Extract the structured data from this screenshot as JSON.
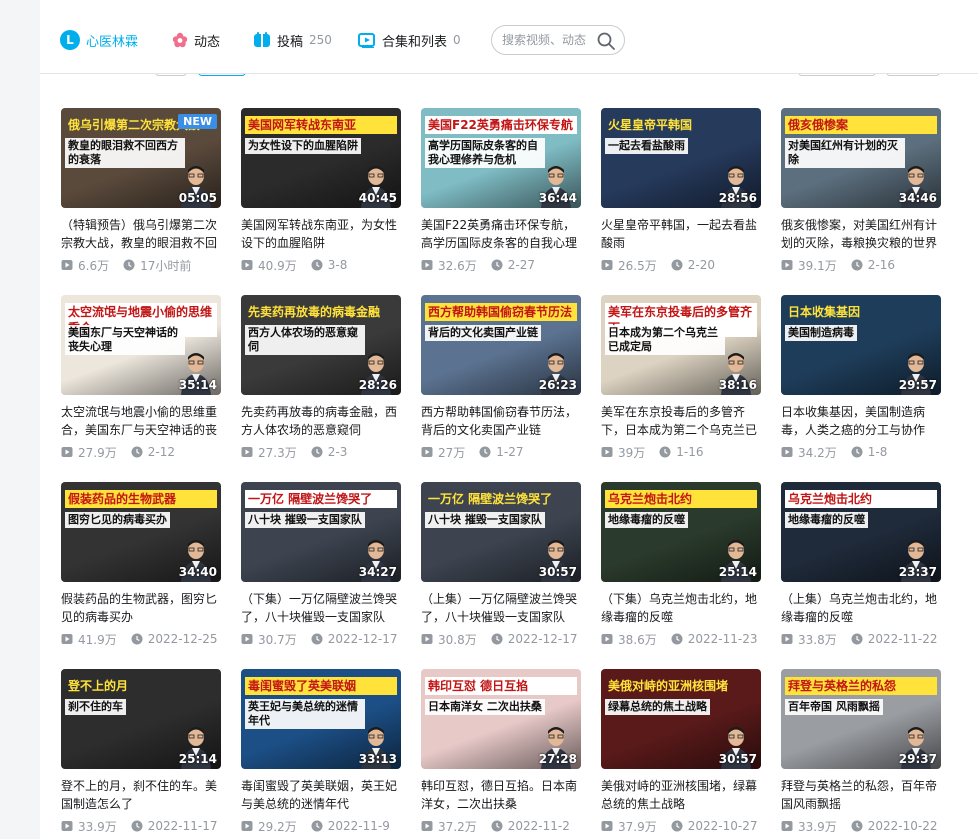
{
  "nav": {
    "home": {
      "label": "心医林霖",
      "badge": "L"
    },
    "dynamic": {
      "label": "动态"
    },
    "posts": {
      "label": "投稿",
      "count": "250"
    },
    "collections": {
      "label": "合集和列表",
      "count": "0"
    },
    "search": {
      "placeholder": "搜索视频、动态"
    }
  },
  "colors": {
    "accent": "#00aeec"
  },
  "videos": [
    {
      "title": "（特辑预告）俄乌引爆第二次宗教大战，教皇的眼泪救不回西方",
      "views": "6.6万",
      "date": "17小时前",
      "duration": "05:05",
      "cover_text": "俄乌引爆第二次宗教大战",
      "cover_sub": "教皇的眼泪救不回西方的衰落",
      "tag": "NEW",
      "bg": "#5a4a3c"
    },
    {
      "title": "美国网军转战东南亚，为女性设下的血腥陷阱",
      "views": "40.9万",
      "date": "3-8",
      "duration": "40:45",
      "cover_text": "美国网军转战东南亚",
      "cover_sub": "为女性设下的血腥陷阱",
      "bg": "#2b2b2b"
    },
    {
      "title": "美国F22英勇痛击环保专航，高学历国际皮条客的自我心理修养与危机",
      "views": "32.6万",
      "date": "2-27",
      "duration": "36:44",
      "cover_text": "美国F22英勇痛击环保专航",
      "cover_sub": "高学历国际皮条客的自我心理修养与危机",
      "bg": "#7fbcc4"
    },
    {
      "title": "火星皇帝平韩国，一起去看盐酸雨",
      "views": "26.5万",
      "date": "2-20",
      "duration": "28:56",
      "cover_text": "火星皇帝平韩国",
      "cover_sub": "一起去看盐酸雨",
      "bg": "#263a5c"
    },
    {
      "title": "俄亥俄惨案，对美国红州有计划的灭除，毒粮换灾粮的世界危机",
      "views": "39.1万",
      "date": "2-16",
      "duration": "34:46",
      "cover_text": "俄亥俄惨案",
      "cover_sub": "对美国红州有计划的灭除",
      "bg": "#5c6f7e"
    },
    {
      "title": "太空流氓与地震小偷的思维重合，美国东厂与天空神话的丧失心理",
      "views": "27.9万",
      "date": "2-12",
      "duration": "35:14",
      "cover_text": "太空流氓与地震小偷的思维重合",
      "cover_sub": "美国东厂与天空神话的丧失心理",
      "bg": "#ece6dc"
    },
    {
      "title": "先卖药再放毒的病毒金融，西方人体农场的恶意窥伺",
      "views": "27.3万",
      "date": "2-3",
      "duration": "28:26",
      "cover_text": "先卖药再放毒的病毒金融",
      "cover_sub": "西方人体农场的恶意窥伺",
      "bg": "#3a3a3a"
    },
    {
      "title": "西方帮助韩国偷窃春节历法，背后的文化卖国产业链",
      "views": "27万",
      "date": "1-27",
      "duration": "26:23",
      "cover_text": "西方帮助韩国偷窃春节历法",
      "cover_sub": "背后的文化卖国产业链",
      "bg": "#5b7290"
    },
    {
      "title": "美军在东京投毒后的多管齐下，日本成为第二个乌克兰已成定局",
      "views": "39万",
      "date": "1-16",
      "duration": "38:16",
      "cover_text": "美军在东京投毒后的多管齐下",
      "cover_sub": "日本成为第二个乌克兰已成定局",
      "bg": "#ddd3c2"
    },
    {
      "title": "日本收集基因，美国制造病毒，人类之癌的分工与协作",
      "views": "34.2万",
      "date": "1-8",
      "duration": "29:57",
      "cover_text": "日本收集基因",
      "cover_sub": "美国制造病毒",
      "bg": "#1e3d5a"
    },
    {
      "title": "假装药品的生物武器，图穷匕见的病毒买办",
      "views": "41.9万",
      "date": "2022-12-25",
      "duration": "34:40",
      "cover_text": "假装药品的生物武器",
      "cover_sub": "图穷匕见的病毒买办",
      "bg": "#333333"
    },
    {
      "title": "（下集）一万亿隔壁波兰馋哭了，八十块催毁一支国家队",
      "views": "30.7万",
      "date": "2022-12-17",
      "duration": "34:27",
      "cover_text": "一万亿 隔壁波兰馋哭了",
      "cover_sub": "八十块 摧毁一支国家队",
      "bg": "#3d4450"
    },
    {
      "title": "（上集）一万亿隔壁波兰馋哭了，八十块催毁一支国家队",
      "views": "30.8万",
      "date": "2022-12-17",
      "duration": "30:57",
      "cover_text": "一万亿 隔壁波兰馋哭了",
      "cover_sub": "八十块 摧毁一支国家队",
      "bg": "#3d4450"
    },
    {
      "title": "（下集）乌克兰炮击北约，地缘毒瘤的反噬",
      "views": "38.6万",
      "date": "2022-11-23",
      "duration": "25:14",
      "cover_text": "乌克兰炮击北约",
      "cover_sub": "地缘毒瘤的反噬",
      "bg": "#2a3a2c"
    },
    {
      "title": "（上集）乌克兰炮击北约，地缘毒瘤的反噬",
      "views": "33.8万",
      "date": "2022-11-22",
      "duration": "23:37",
      "cover_text": "乌克兰炮击北约",
      "cover_sub": "地缘毒瘤的反噬",
      "bg": "#1f2a3a"
    },
    {
      "title": "登不上的月，刹不住的车。美国制造怎么了",
      "views": "33.9万",
      "date": "2022-11-17",
      "duration": "25:14",
      "cover_text": "登不上的月",
      "cover_sub": "刹不住的车",
      "bg": "#2d2d2d"
    },
    {
      "title": "毒闺蜜毁了英美联姻，英王妃与美总统的迷情年代",
      "views": "29.2万",
      "date": "2022-11-9",
      "duration": "33:13",
      "cover_text": "毒闺蜜毁了英美联姻",
      "cover_sub": "英王妃与美总统的迷情年代",
      "bg": "#1c4f86"
    },
    {
      "title": "韩印互怼，德日互掐。日本南洋女，二次出扶桑",
      "views": "37.2万",
      "date": "2022-11-2",
      "duration": "27:28",
      "cover_text": "韩印互怼 德日互掐",
      "cover_sub": "日本南洋女 二次出扶桑",
      "bg": "#e7c9c8"
    },
    {
      "title": "美俄对峙的亚洲核围堵，绿幕总统的焦土战略",
      "views": "37.9万",
      "date": "2022-10-27",
      "duration": "30:57",
      "cover_text": "美俄对峙的亚洲核围堵",
      "cover_sub": "绿幕总统的焦土战略",
      "bg": "#5a1a1a"
    },
    {
      "title": "拜登与英格兰的私怨，百年帝国风雨飘摇",
      "views": "33.9万",
      "date": "2022-10-22",
      "duration": "29:37",
      "cover_text": "拜登与英格兰的私怨",
      "cover_sub": "百年帝国 风雨飘摇",
      "bg": "#9a9da2"
    }
  ]
}
